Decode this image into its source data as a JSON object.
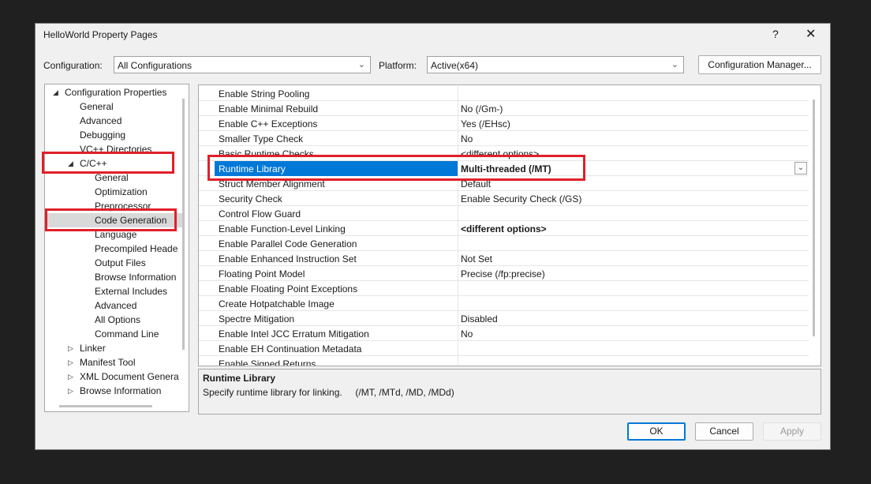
{
  "window": {
    "title": "HelloWorld Property Pages",
    "help_label": "?",
    "close_label": "✕"
  },
  "toolbar": {
    "configuration_label": "Configuration:",
    "configuration_value": "All Configurations",
    "platform_label": "Platform:",
    "platform_value": "Active(x64)",
    "config_manager_label": "Configuration Manager..."
  },
  "tree": {
    "items": [
      {
        "label": "Configuration Properties",
        "expanded": true
      },
      {
        "label": "General"
      },
      {
        "label": "Advanced"
      },
      {
        "label": "Debugging"
      },
      {
        "label": "VC++ Directories"
      },
      {
        "label": "C/C++",
        "expanded": true
      },
      {
        "label": "General"
      },
      {
        "label": "Optimization"
      },
      {
        "label": "Preprocessor"
      },
      {
        "label": "Code Generation",
        "selected": true
      },
      {
        "label": "Language"
      },
      {
        "label": "Precompiled Heade"
      },
      {
        "label": "Output Files"
      },
      {
        "label": "Browse Information"
      },
      {
        "label": "External Includes"
      },
      {
        "label": "Advanced"
      },
      {
        "label": "All Options"
      },
      {
        "label": "Command Line"
      },
      {
        "label": "Linker",
        "expanded": false
      },
      {
        "label": "Manifest Tool",
        "expanded": false
      },
      {
        "label": "XML Document Genera",
        "expanded": false
      },
      {
        "label": "Browse Information",
        "expanded": false
      }
    ]
  },
  "properties": [
    {
      "name": "Enable String Pooling",
      "value": ""
    },
    {
      "name": "Enable Minimal Rebuild",
      "value": "No (/Gm-)"
    },
    {
      "name": "Enable C++ Exceptions",
      "value": "Yes (/EHsc)"
    },
    {
      "name": "Smaller Type Check",
      "value": "No"
    },
    {
      "name": "Basic Runtime Checks",
      "value": "<different options>"
    },
    {
      "name": "Runtime Library",
      "value": "Multi-threaded (/MT)",
      "selected": true
    },
    {
      "name": "Struct Member Alignment",
      "value": "Default"
    },
    {
      "name": "Security Check",
      "value": "Enable Security Check (/GS)"
    },
    {
      "name": "Control Flow Guard",
      "value": ""
    },
    {
      "name": "Enable Function-Level Linking",
      "value": "<different options>",
      "bold": true
    },
    {
      "name": "Enable Parallel Code Generation",
      "value": ""
    },
    {
      "name": "Enable Enhanced Instruction Set",
      "value": "Not Set"
    },
    {
      "name": "Floating Point Model",
      "value": "Precise (/fp:precise)"
    },
    {
      "name": "Enable Floating Point Exceptions",
      "value": ""
    },
    {
      "name": "Create Hotpatchable Image",
      "value": ""
    },
    {
      "name": "Spectre Mitigation",
      "value": "Disabled"
    },
    {
      "name": "Enable Intel JCC Erratum Mitigation",
      "value": "No"
    },
    {
      "name": "Enable EH Continuation Metadata",
      "value": ""
    },
    {
      "name": "Enable Signed Returns",
      "value": ""
    }
  ],
  "description": {
    "title": "Runtime Library",
    "text": "Specify runtime library for linking.     (/MT, /MTd, /MD, /MDd)"
  },
  "buttons": {
    "ok": "OK",
    "cancel": "Cancel",
    "apply": "Apply"
  },
  "colors": {
    "accent": "#0078d7",
    "highlight_box": "#e0202a"
  }
}
